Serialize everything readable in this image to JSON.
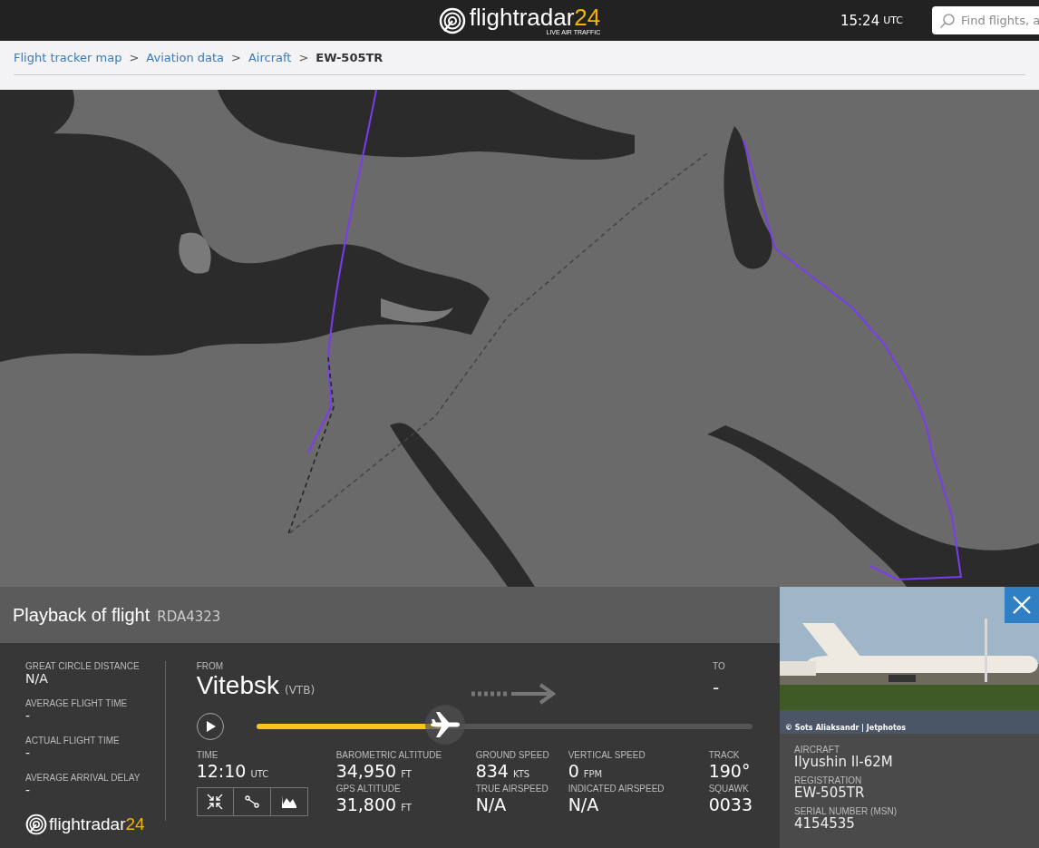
{
  "header": {
    "logo": {
      "name": "flightradar",
      "name_accent": "24",
      "tagline": "LIVE AIR TRAFFIC"
    },
    "time": "15:24",
    "time_zone": "UTC",
    "search": {
      "placeholder": "Find flights, a"
    }
  },
  "breadcrumb": [
    {
      "label": "Flight tracker map",
      "current": false
    },
    {
      "label": "Aviation data",
      "current": false
    },
    {
      "label": "Aircraft",
      "current": false
    },
    {
      "label": "EW-505TR",
      "current": true
    }
  ],
  "breadcrumb_separator": ">",
  "playback": {
    "title": "Playback of flight",
    "flight": "RDA4323"
  },
  "summary": [
    {
      "label": "GREAT CIRCLE DISTANCE",
      "value": "N/A"
    },
    {
      "label": "AVERAGE FLIGHT TIME",
      "value": "-"
    },
    {
      "label": "ACTUAL FLIGHT TIME",
      "value": "-"
    },
    {
      "label": "AVERAGE ARRIVAL DELAY",
      "value": "-"
    }
  ],
  "route": {
    "from_label": "FROM",
    "from_city": "Vitebsk",
    "from_code": "(VTB)",
    "to_label": "TO",
    "to_value": "-"
  },
  "timeline": {
    "level": 0.38,
    "playing": false
  },
  "stats": [
    {
      "label": "TIME",
      "value": "12:10",
      "unit": "UTC"
    },
    {
      "label": "BAROMETRIC ALTITUDE",
      "value": "34,950",
      "unit": "FT"
    },
    {
      "label": "GROUND SPEED",
      "value": "834",
      "unit": "KTS"
    },
    {
      "label": "VERTICAL SPEED",
      "value": "0",
      "unit": "FPM"
    },
    {
      "label": "TRACK",
      "value": "190°"
    },
    {
      "label": "GPS ALTITUDE",
      "value": "31,800",
      "unit": "FT"
    },
    {
      "label": "TRUE AIRSPEED",
      "value": "N/A"
    },
    {
      "label": "INDICATED AIRSPEED",
      "value": "N/A"
    },
    {
      "label": "SQUAWK",
      "value": "0033"
    }
  ],
  "view_buttons": [
    {
      "kind": "collapse"
    },
    {
      "kind": "route"
    },
    {
      "kind": "chart"
    }
  ],
  "footer_logo": {
    "name": "flightradar",
    "name_accent": "24"
  },
  "aircraft_panel": {
    "photo_credit": "© Sots Aliaksandr | Jetphotos",
    "details": [
      {
        "label": "AIRCRAFT",
        "value": "Ilyushin Il-62M"
      },
      {
        "label": "REGISTRATION",
        "value": "EW-505TR"
      },
      {
        "label": "SERIAL NUMBER (MSN)",
        "value": "4154535"
      }
    ]
  }
}
